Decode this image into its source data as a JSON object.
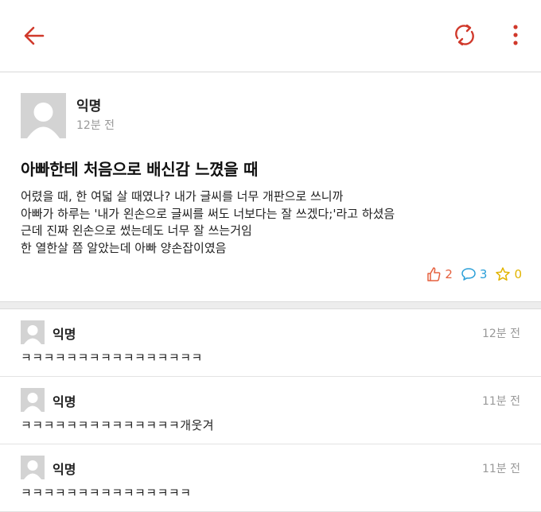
{
  "colors": {
    "accent": "#d0392b",
    "like": "#e5603e",
    "comment": "#2a9fd8",
    "scrap": "#e2b400"
  },
  "icons": {
    "back": "arrow-left-icon",
    "refresh": "refresh-icon",
    "more": "more-vertical-icon"
  },
  "post": {
    "author": "익명",
    "time": "12분 전",
    "title": "아빠한테 처음으로 배신감 느꼈을 때",
    "body": "어렸을 때, 한 여덟 살 때였나? 내가 글씨를 너무 개판으로 쓰니까\n아빠가 하루는 '내가 왼손으로 글씨를 써도 너보다는 잘 쓰겠다;'라고 하셨음\n근데 진짜 왼손으로 썼는데도 너무 잘 쓰는거임\n한 열한살 쯤 알았는데 아빠 양손잡이였음",
    "likes": "2",
    "comments": "3",
    "scraps": "0"
  },
  "comments": [
    {
      "author": "익명",
      "time": "12분 전",
      "text": "ㅋㅋㅋㅋㅋㅋㅋㅋㅋㅋㅋㅋㅋㅋㅋㅋ"
    },
    {
      "author": "익명",
      "time": "11분 전",
      "text": "ㅋㅋㅋㅋㅋㅋㅋㅋㅋㅋㅋㅋㅋㅋ개웃겨"
    },
    {
      "author": "익명",
      "time": "11분 전",
      "text": "ㅋㅋㅋㅋㅋㅋㅋㅋㅋㅋㅋㅋㅋㅋㅋ"
    }
  ]
}
